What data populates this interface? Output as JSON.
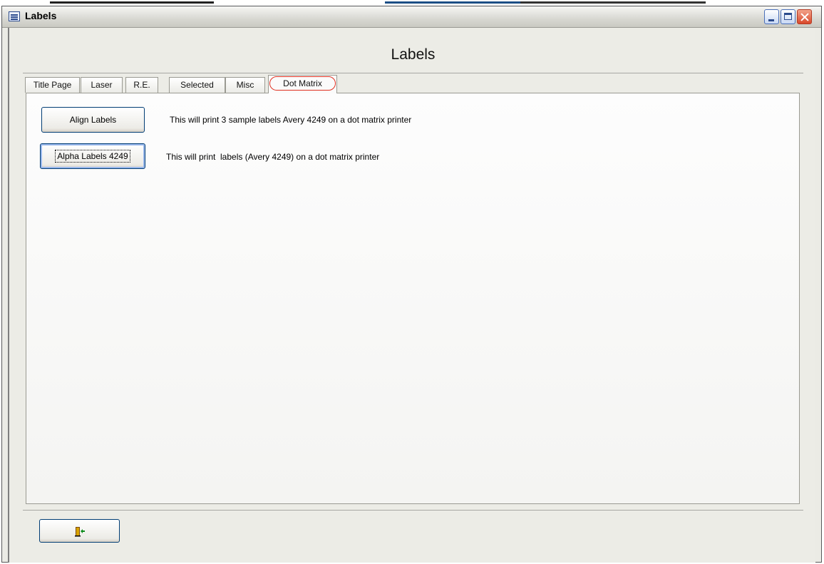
{
  "window": {
    "title": "Labels",
    "controls": [
      "minimize",
      "maximize",
      "close"
    ],
    "close_color": "#d9482a"
  },
  "form": {
    "heading": "Labels"
  },
  "tabs": [
    {
      "label": "Title Page",
      "active": false
    },
    {
      "label": "Laser",
      "active": false
    },
    {
      "label": "R.E.",
      "active": false
    },
    {
      "label": "Selected",
      "active": false
    },
    {
      "label": "Misc",
      "active": false
    },
    {
      "label": "Dot Matrix",
      "active": true
    }
  ],
  "panel": {
    "align_button": "Align Labels",
    "align_desc": "This will print 3 sample labels Avery 4249 on a dot matrix printer",
    "alpha_button": "Alpha Labels 4249",
    "alpha_desc": "This will print  labels (Avery 4249) on a dot matrix printer"
  },
  "footer": {
    "exit_icon": "exit-door-icon"
  },
  "colors": {
    "tab_highlight": "#e03020",
    "button_border": "#003c74"
  }
}
